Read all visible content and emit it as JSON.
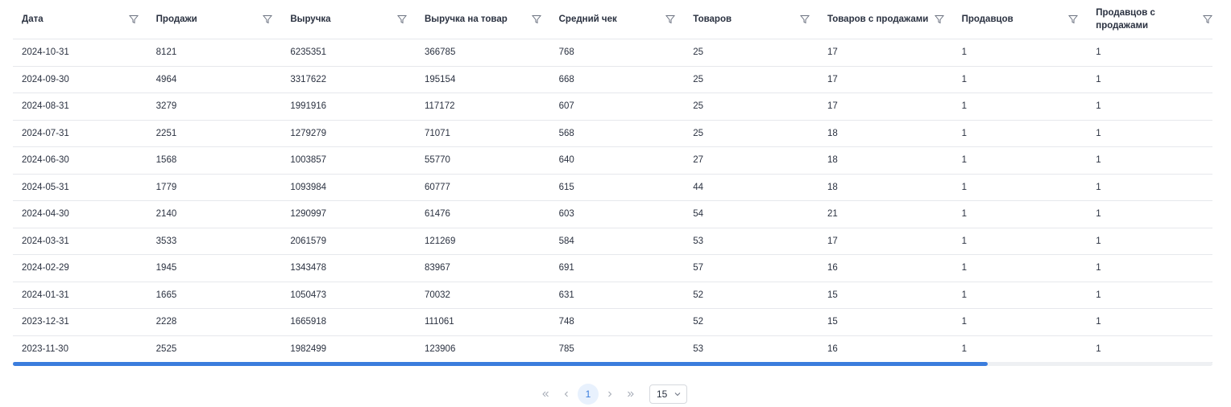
{
  "table": {
    "columns": [
      "Дата",
      "Продажи",
      "Выручка",
      "Выручка на товар",
      "Средний чек",
      "Товаров",
      "Товаров с продажами",
      "Продавцов",
      "Продавцов с продажами"
    ],
    "rows": [
      [
        "2024-10-31",
        "8121",
        "6235351",
        "366785",
        "768",
        "25",
        "17",
        "1",
        "1"
      ],
      [
        "2024-09-30",
        "4964",
        "3317622",
        "195154",
        "668",
        "25",
        "17",
        "1",
        "1"
      ],
      [
        "2024-08-31",
        "3279",
        "1991916",
        "117172",
        "607",
        "25",
        "17",
        "1",
        "1"
      ],
      [
        "2024-07-31",
        "2251",
        "1279279",
        "71071",
        "568",
        "25",
        "18",
        "1",
        "1"
      ],
      [
        "2024-06-30",
        "1568",
        "1003857",
        "55770",
        "640",
        "27",
        "18",
        "1",
        "1"
      ],
      [
        "2024-05-31",
        "1779",
        "1093984",
        "60777",
        "615",
        "44",
        "18",
        "1",
        "1"
      ],
      [
        "2024-04-30",
        "2140",
        "1290997",
        "61476",
        "603",
        "54",
        "21",
        "1",
        "1"
      ],
      [
        "2024-03-31",
        "3533",
        "2061579",
        "121269",
        "584",
        "53",
        "17",
        "1",
        "1"
      ],
      [
        "2024-02-29",
        "1945",
        "1343478",
        "83967",
        "691",
        "57",
        "16",
        "1",
        "1"
      ],
      [
        "2024-01-31",
        "1665",
        "1050473",
        "70032",
        "631",
        "52",
        "15",
        "1",
        "1"
      ],
      [
        "2023-12-31",
        "2228",
        "1665918",
        "111061",
        "748",
        "52",
        "15",
        "1",
        "1"
      ],
      [
        "2023-11-30",
        "2525",
        "1982499",
        "123906",
        "785",
        "53",
        "16",
        "1",
        "1"
      ]
    ]
  },
  "pagination": {
    "current_page": "1",
    "page_size": "15"
  },
  "icons": {
    "filter": "filter-icon",
    "first": "double-chevron-left-icon",
    "prev": "chevron-left-icon",
    "next": "chevron-right-icon",
    "last": "double-chevron-right-icon",
    "dropdown": "chevron-down-icon"
  },
  "colors": {
    "accent": "#3b7ddd",
    "text": "#2a3140",
    "muted": "#a2a8b3",
    "border": "#e6e8ec"
  }
}
